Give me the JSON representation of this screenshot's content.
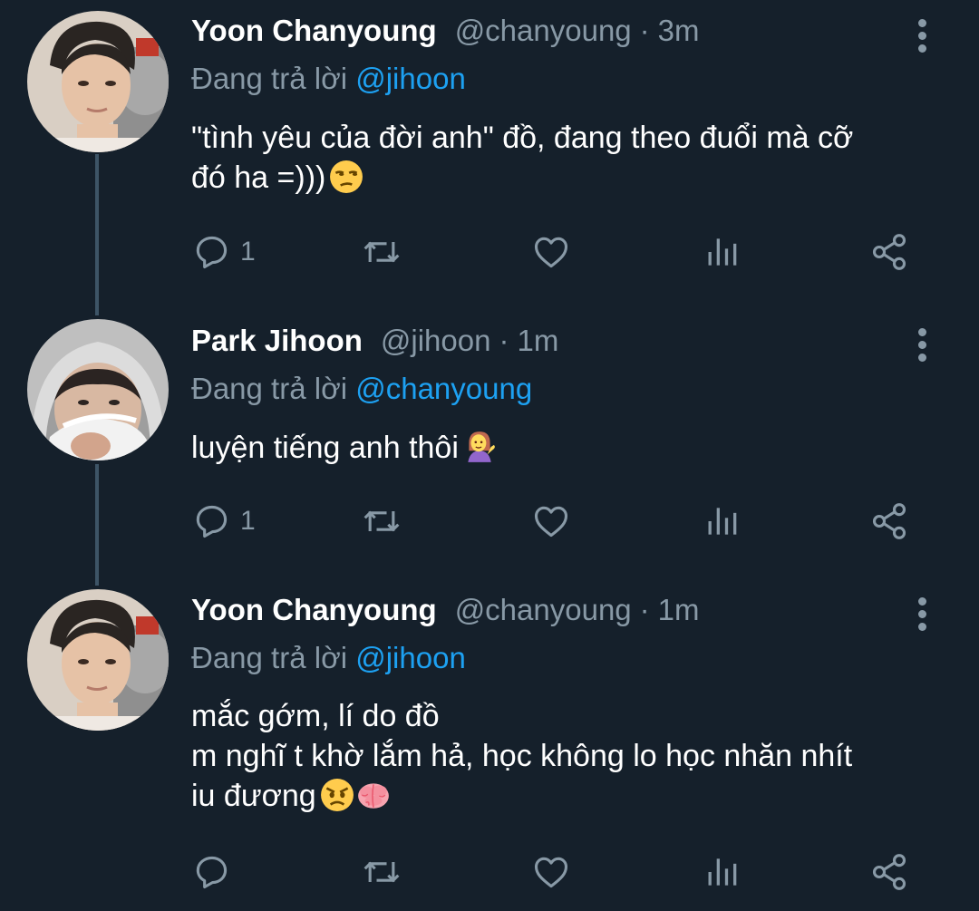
{
  "tweets": [
    {
      "name": "Yoon Chanyoung",
      "handle": "@chanyoung",
      "separator": "·",
      "time": "3m",
      "reply_prefix": "Đang trả lời",
      "reply_to": "@jihoon",
      "text_lines": [
        "\"tình yêu của đời anh\" đồ, đang theo đuổi mà cỡ",
        "đó ha =)))"
      ],
      "emojis": [
        "unamused-face"
      ],
      "reply_count": "1"
    },
    {
      "name": "Park Jihoon",
      "handle": "@jihoon",
      "separator": "·",
      "time": "1m",
      "reply_prefix": "Đang trả lời",
      "reply_to": "@chanyoung",
      "text_lines": [
        "luyện tiếng anh thôi"
      ],
      "emojis": [
        "information-desk-person"
      ],
      "reply_count": "1"
    },
    {
      "name": "Yoon Chanyoung",
      "handle": "@chanyoung",
      "separator": "·",
      "time": "1m",
      "reply_prefix": "Đang trả lời",
      "reply_to": "@jihoon",
      "text_lines": [
        "mắc gớm, lí do đồ",
        "m nghĩ t khờ lắm hả, học không lo học nhăn nhít",
        "iu đương"
      ],
      "emojis": [
        "angry-face",
        "brain"
      ],
      "reply_count": ""
    }
  ],
  "colors": {
    "background": "#15202b",
    "text": "#ffffff",
    "muted": "#8899a6",
    "mention": "#1da1f2",
    "thread_line": "#3d5466"
  },
  "icons": [
    "reply-icon",
    "retweet-icon",
    "like-icon",
    "analytics-icon",
    "share-icon",
    "more-options-icon"
  ]
}
